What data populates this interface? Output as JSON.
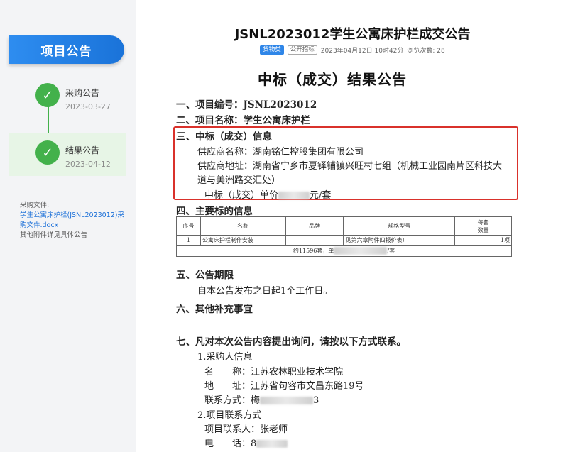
{
  "sidebar": {
    "header": "项目公告",
    "steps": [
      {
        "label": "采购公告",
        "date": "2023-03-27"
      },
      {
        "label": "结果公告",
        "date": "2023-04-12"
      }
    ],
    "files_label": "采购文件:",
    "file_link": "学生公寓床护栏(JSNL2023012)采购文件.docx",
    "files_note": "其他附件详见具体公告"
  },
  "header": {
    "title": "JSNL2023012学生公寓床护栏成交公告",
    "tag_category": "货物类",
    "tag_method": "公开招标",
    "datetime": "2023年04月12日 10时42分",
    "views": "浏览次数: 28"
  },
  "doc": {
    "heading": "中标（成交）结果公告",
    "s1": "一、项目编号：JSNL2023012",
    "s2": "二、项目名称：学生公寓床护栏",
    "s3": "三、中标（成交）信息",
    "supplier_name": "供应商名称：湖南铭仁控股集团有限公司",
    "supplier_addr_1": "供应商地址：湖南省宁乡市夏铎铺镇兴旺村七组（机械工业园南片区科技大",
    "supplier_addr_2": "道与美洲路交汇处）",
    "price_prefix": "中标（成交）单价",
    "price_suffix": "元/套",
    "s4": "四、主要标的信息",
    "s5": "五、公告期限",
    "s5_text": "自本公告发布之日起1个工作日。",
    "s6": "六、其他补充事宜",
    "s7": "七、凡对本次公告内容提出询问，请按以下方式联系。",
    "c1_title": "1.采购人信息",
    "c1_name": "名　　称：江苏农林职业技术学院",
    "c1_addr": "地　　址：江苏省句容市文昌东路19号",
    "c1_contact_prefix": "联系方式：梅",
    "c1_contact_suffix": "3",
    "c2_title": "2.项目联系方式",
    "c2_person": "项目联系人：张老师",
    "c2_phone_prefix": "电　　话：8"
  },
  "table": {
    "headers": [
      "序号",
      "名称",
      "品牌",
      "规格型号",
      "每套",
      "数量"
    ],
    "row": [
      "1",
      "公寓床护栏制作安装",
      "",
      "见第六章附件四报价表）",
      "1项"
    ],
    "total_prefix": "约11596套，单",
    "total_suffix": "/套"
  },
  "colors": {
    "accent_blue": "#1a73d9",
    "step_green": "#43b14b",
    "highlight_red": "#d9312b"
  }
}
